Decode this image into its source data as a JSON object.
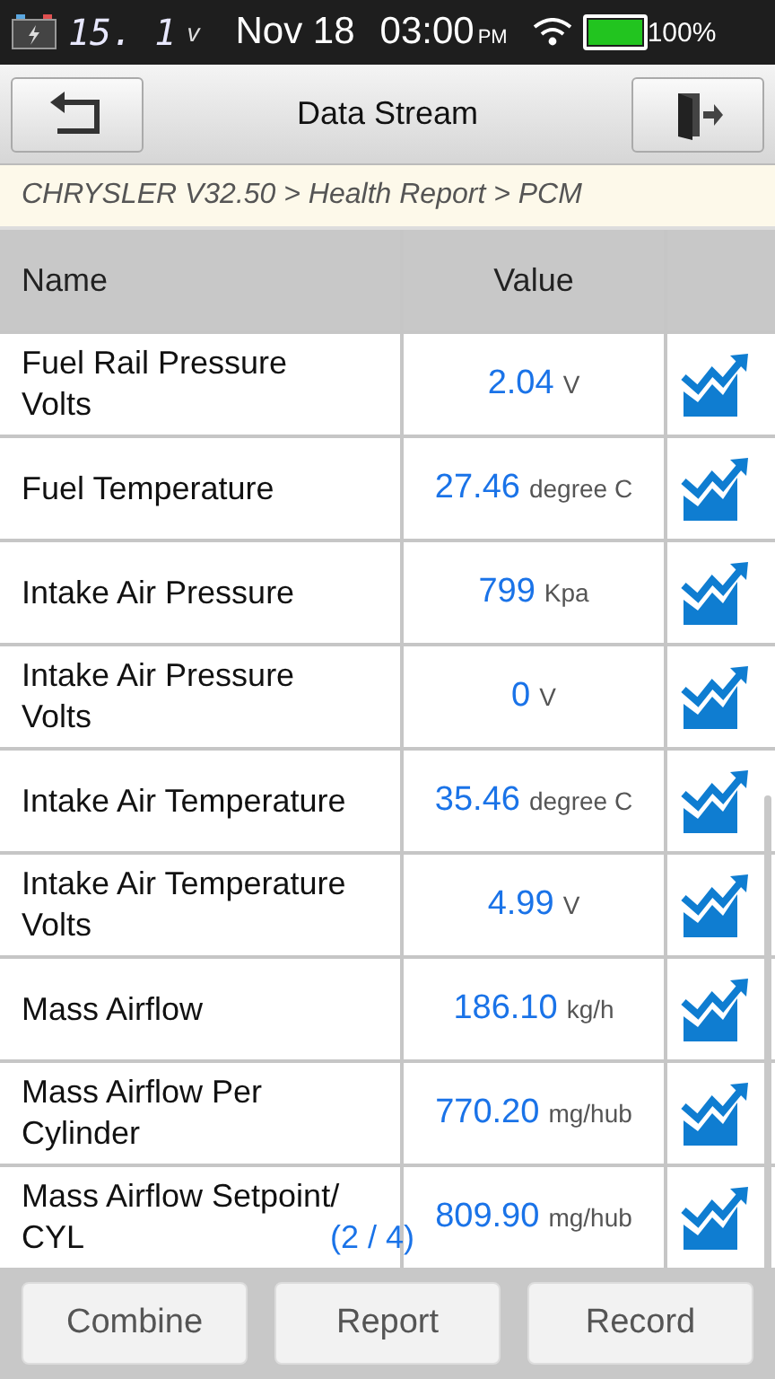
{
  "status_bar": {
    "voltage": "15. 1",
    "voltage_unit": "v",
    "date": "Nov 18",
    "time": "03:00",
    "meridiem": "PM",
    "battery": "100%"
  },
  "toolbar": {
    "title": "Data Stream"
  },
  "breadcrumb": "CHRYSLER V32.50 > Health Report > PCM",
  "table": {
    "columns": [
      "Name",
      "Value"
    ],
    "rows": [
      {
        "name": "Fuel Rail Pressure Volts",
        "value": "2.04",
        "unit": "V"
      },
      {
        "name": "Fuel Temperature",
        "value": "27.46",
        "unit": "degree C"
      },
      {
        "name": "Intake Air Pressure",
        "value": "799",
        "unit": "Kpa"
      },
      {
        "name": "Intake Air Pressure Volts",
        "value": "0",
        "unit": "V"
      },
      {
        "name": "Intake Air Temperature",
        "value": "35.46",
        "unit": "degree C"
      },
      {
        "name": "Intake Air Temperature Volts",
        "value": "4.99",
        "unit": "V"
      },
      {
        "name": "Mass Airflow",
        "value": "186.10",
        "unit": "kg/h"
      },
      {
        "name": "Mass Airflow Per Cylinder",
        "value": "770.20",
        "unit": "mg/hub"
      },
      {
        "name": "Mass Airflow Setpoint/ CYL",
        "value": "809.90",
        "unit": "mg/hub"
      }
    ]
  },
  "page_indicator": "(2 / 4)",
  "buttons": [
    "Combine",
    "Report",
    "Record"
  ]
}
